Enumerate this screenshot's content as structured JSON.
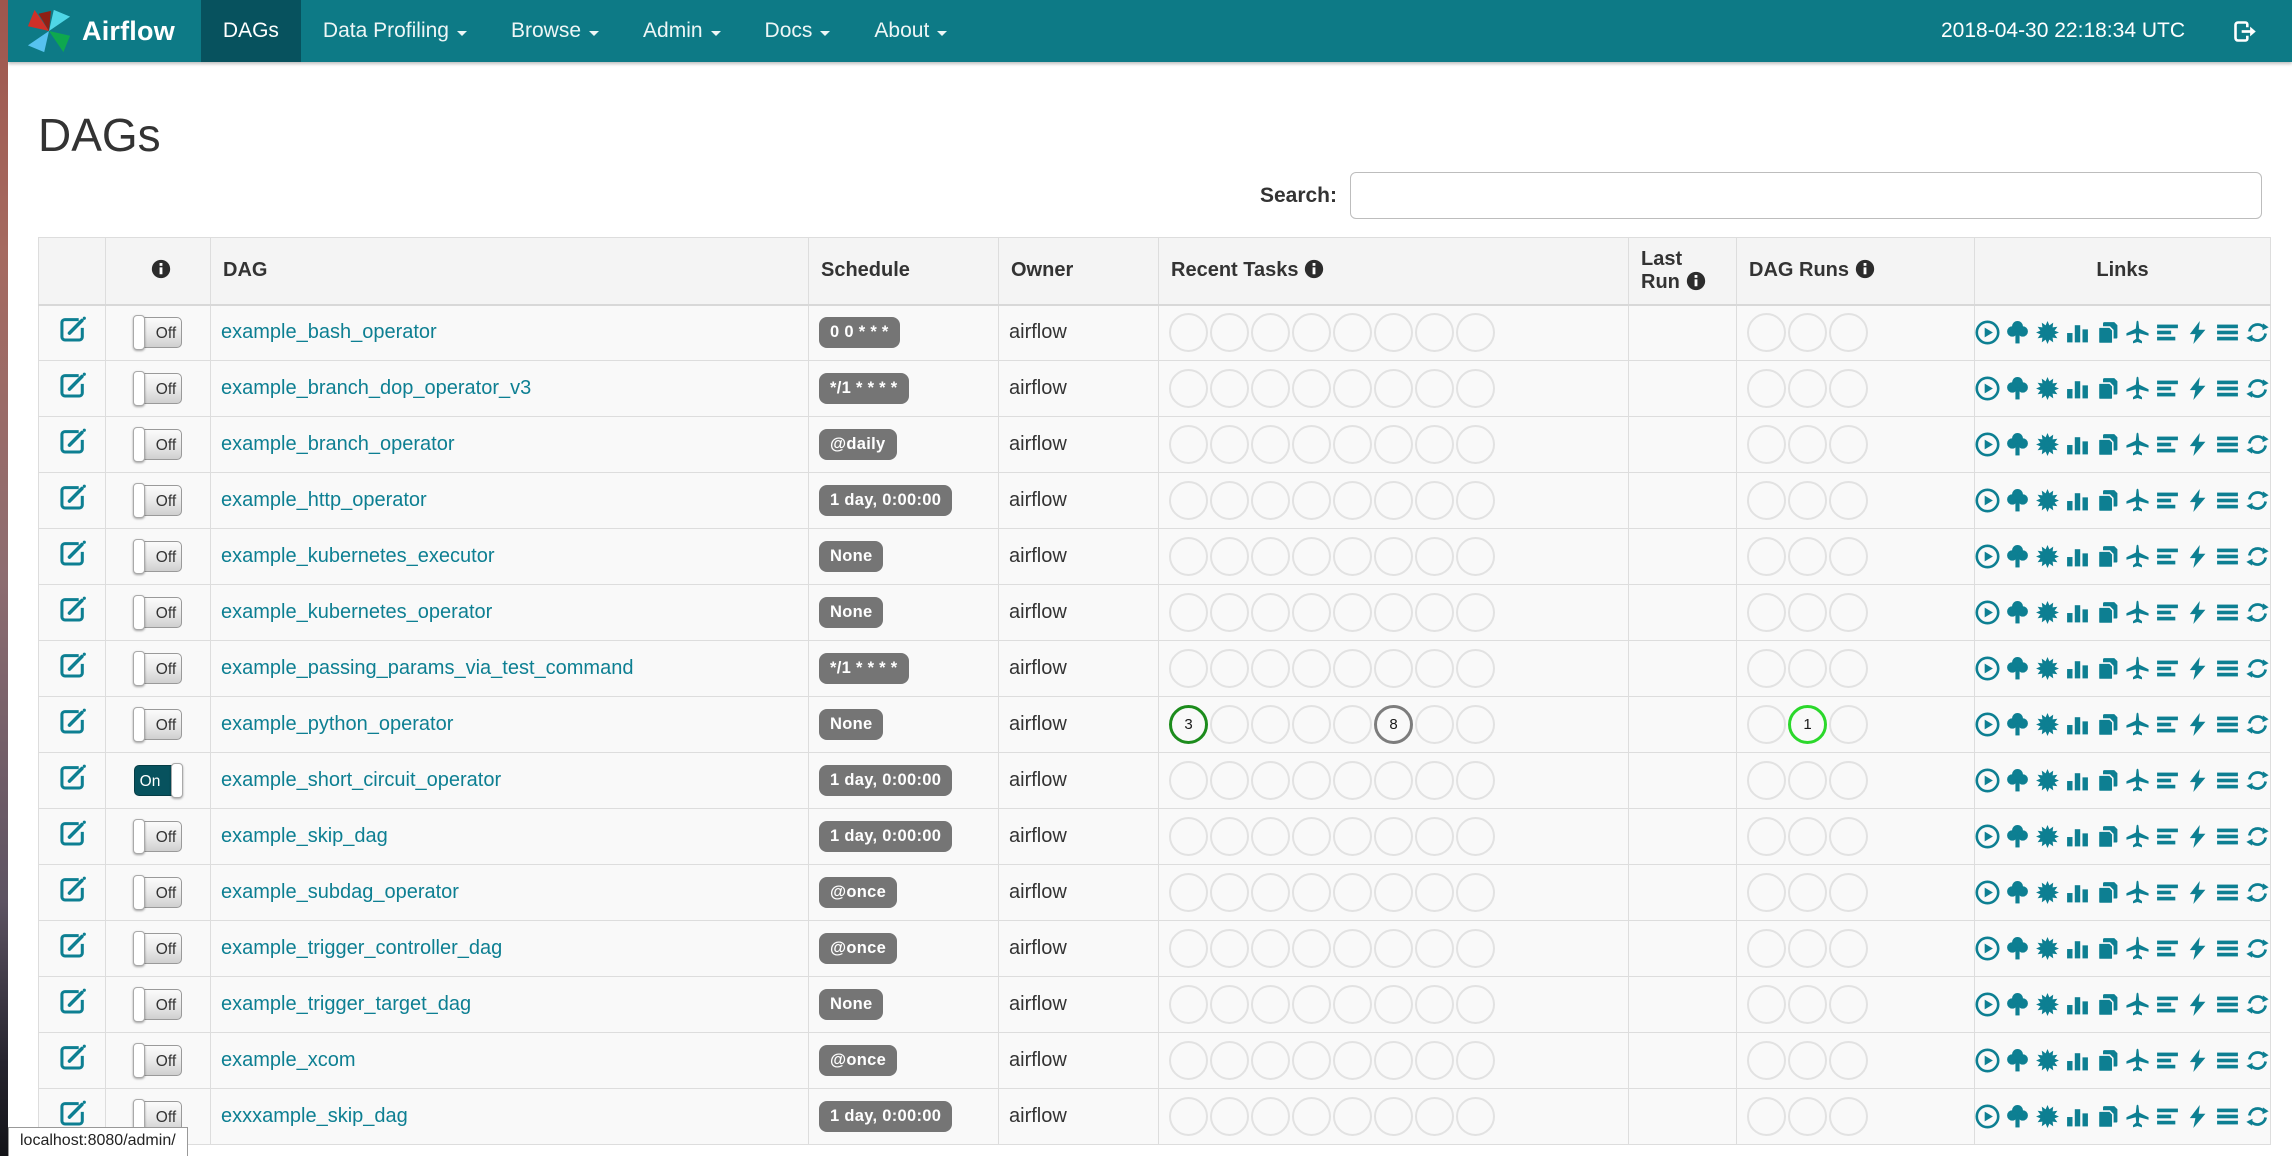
{
  "navbar": {
    "brand": "Airflow",
    "items": [
      {
        "label": "DAGs",
        "active": true,
        "caret": false
      },
      {
        "label": "Data Profiling",
        "active": false,
        "caret": true
      },
      {
        "label": "Browse",
        "active": false,
        "caret": true
      },
      {
        "label": "Admin",
        "active": false,
        "caret": true
      },
      {
        "label": "Docs",
        "active": false,
        "caret": true
      },
      {
        "label": "About",
        "active": false,
        "caret": true
      }
    ],
    "clock": "2018-04-30 22:18:34 UTC"
  },
  "page": {
    "title": "DAGs",
    "search_label": "Search:",
    "search_value": "",
    "status_url": "localhost:8080/admin/",
    "toggle_on_label": "On",
    "toggle_off_label": "Off"
  },
  "table": {
    "headers": {
      "dag": "DAG",
      "schedule": "Schedule",
      "owner": "Owner",
      "recent_tasks": "Recent Tasks",
      "last_run": "Last Run",
      "dag_runs": "DAG Runs",
      "links": "Links"
    },
    "recent_task_slots": 8,
    "dag_run_slots": 3,
    "rows": [
      {
        "dag_id": "example_bash_operator",
        "schedule": "0 0 * * *",
        "owner": "airflow",
        "paused": true,
        "last_run": "",
        "recent_tasks": [],
        "dag_runs": []
      },
      {
        "dag_id": "example_branch_dop_operator_v3",
        "schedule": "*/1 * * * *",
        "owner": "airflow",
        "paused": true,
        "last_run": "",
        "recent_tasks": [],
        "dag_runs": []
      },
      {
        "dag_id": "example_branch_operator",
        "schedule": "@daily",
        "owner": "airflow",
        "paused": true,
        "last_run": "",
        "recent_tasks": [],
        "dag_runs": []
      },
      {
        "dag_id": "example_http_operator",
        "schedule": "1 day, 0:00:00",
        "owner": "airflow",
        "paused": true,
        "last_run": "",
        "recent_tasks": [],
        "dag_runs": []
      },
      {
        "dag_id": "example_kubernetes_executor",
        "schedule": "None",
        "owner": "airflow",
        "paused": true,
        "last_run": "",
        "recent_tasks": [],
        "dag_runs": []
      },
      {
        "dag_id": "example_kubernetes_operator",
        "schedule": "None",
        "owner": "airflow",
        "paused": true,
        "last_run": "",
        "recent_tasks": [],
        "dag_runs": []
      },
      {
        "dag_id": "example_passing_params_via_test_command",
        "schedule": "*/1 * * * *",
        "owner": "airflow",
        "paused": true,
        "last_run": "",
        "recent_tasks": [],
        "dag_runs": []
      },
      {
        "dag_id": "example_python_operator",
        "schedule": "None",
        "owner": "airflow",
        "paused": true,
        "last_run": "",
        "recent_tasks": [
          {
            "slot": 1,
            "count": 3,
            "state": "success"
          },
          {
            "slot": 6,
            "count": 8,
            "state": "queued"
          }
        ],
        "dag_runs": [
          {
            "slot": 2,
            "count": 1,
            "state": "running"
          }
        ]
      },
      {
        "dag_id": "example_short_circuit_operator",
        "schedule": "1 day, 0:00:00",
        "owner": "airflow",
        "paused": false,
        "last_run": "",
        "recent_tasks": [],
        "dag_runs": []
      },
      {
        "dag_id": "example_skip_dag",
        "schedule": "1 day, 0:00:00",
        "owner": "airflow",
        "paused": true,
        "last_run": "",
        "recent_tasks": [],
        "dag_runs": []
      },
      {
        "dag_id": "example_subdag_operator",
        "schedule": "@once",
        "owner": "airflow",
        "paused": true,
        "last_run": "",
        "recent_tasks": [],
        "dag_runs": []
      },
      {
        "dag_id": "example_trigger_controller_dag",
        "schedule": "@once",
        "owner": "airflow",
        "paused": true,
        "last_run": "",
        "recent_tasks": [],
        "dag_runs": []
      },
      {
        "dag_id": "example_trigger_target_dag",
        "schedule": "None",
        "owner": "airflow",
        "paused": true,
        "last_run": "",
        "recent_tasks": [],
        "dag_runs": []
      },
      {
        "dag_id": "example_xcom",
        "schedule": "@once",
        "owner": "airflow",
        "paused": true,
        "last_run": "",
        "recent_tasks": [],
        "dag_runs": []
      },
      {
        "dag_id": "exxxample_skip_dag",
        "schedule": "1 day, 0:00:00",
        "owner": "airflow",
        "paused": true,
        "last_run": "",
        "recent_tasks": [],
        "dag_runs": []
      }
    ],
    "link_icons": [
      "play-circle",
      "tree",
      "starburst",
      "bar-chart",
      "copy",
      "plane",
      "align-left",
      "bolt",
      "justify",
      "refresh"
    ]
  },
  "colors": {
    "navbar": "#0d7a86",
    "navbar_active": "#07525e",
    "accent": "#0d7f92",
    "badge": "#757575",
    "toggle_on": "#07525e",
    "states": {
      "success": "#1c8c1c",
      "queued": "#7d7d7d",
      "running": "#2bd82b"
    }
  }
}
